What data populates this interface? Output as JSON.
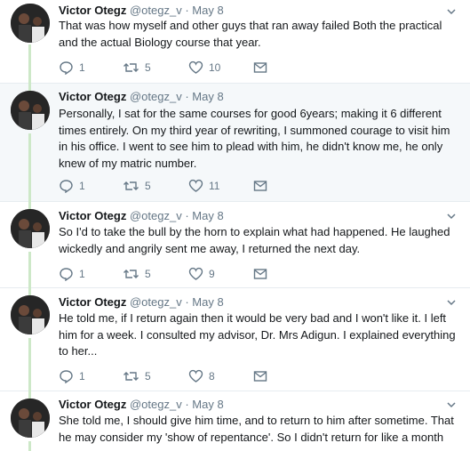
{
  "colors": {
    "thread_line": "#cde8c8",
    "highlight_bg": "#f5f8fa",
    "secondary_text": "#657786",
    "primary_text": "#14171a"
  },
  "tweets": [
    {
      "name": "Victor Otegz",
      "handle": "@otegz_v",
      "dot": "·",
      "date": "May 8",
      "text": "That was how myself and other guys that ran away failed Both the practical and the actual Biology course that year.",
      "replies": "1",
      "retweets": "5",
      "likes": "10"
    },
    {
      "name": "Victor Otegz",
      "handle": "@otegz_v",
      "dot": "·",
      "date": "May 8",
      "text": "Personally, I sat for the same courses for good 6years; making it 6 different times entirely. On my third year of rewriting, I summoned courage to visit him in his office. I went to see him to plead with him, he didn't know me, he only knew of my matric number.",
      "replies": "1",
      "retweets": "5",
      "likes": "11"
    },
    {
      "name": "Victor Otegz",
      "handle": "@otegz_v",
      "dot": "·",
      "date": "May 8",
      "text": "So I'd to take the bull by the horn to explain what had happened. He laughed wickedly and angrily sent me away, I returned the next day.",
      "replies": "1",
      "retweets": "5",
      "likes": "9"
    },
    {
      "name": "Victor Otegz",
      "handle": "@otegz_v",
      "dot": "·",
      "date": "May 8",
      "text": "He told me, if I return again then it would be very bad and I won't like it. I left him for a week. I consulted my advisor, Dr. Mrs Adigun. I explained everything to her...",
      "replies": "1",
      "retweets": "5",
      "likes": "8"
    },
    {
      "name": "Victor Otegz",
      "handle": "@otegz_v",
      "dot": "·",
      "date": "May 8",
      "text": "She told me, I should give him time, and to return to him after sometime. That he may consider my 'show of repentance'. So I didn't return for like a month",
      "replies": "",
      "retweets": "",
      "likes": ""
    }
  ]
}
